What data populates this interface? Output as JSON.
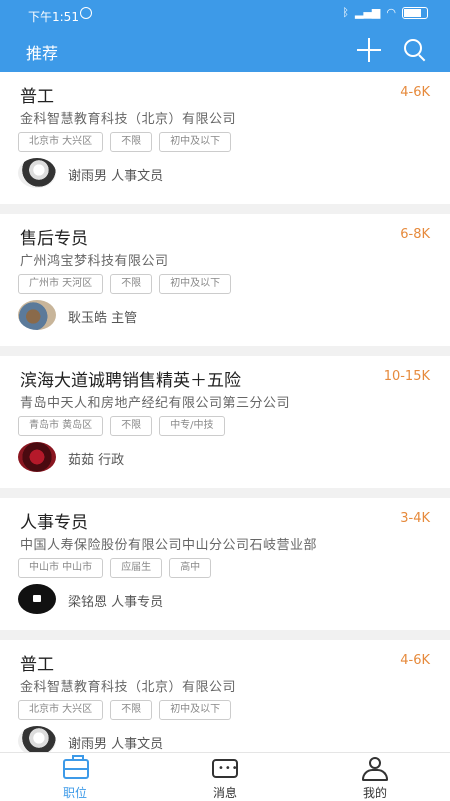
{
  "status": {
    "time": "下午1:51"
  },
  "appbar": {
    "title": "推荐"
  },
  "jobs": [
    {
      "title": "普工",
      "salary": "4-6K",
      "company": "金科智慧教育科技（北京）有限公司",
      "tags": [
        "北京市 大兴区",
        "不限",
        "初中及以下"
      ],
      "contact": "谢雨男 人事文员"
    },
    {
      "title": "售后专员",
      "salary": "6-8K",
      "company": "广州鸿宝梦科技有限公司",
      "tags": [
        "广州市 天河区",
        "不限",
        "初中及以下"
      ],
      "contact": "耿玉皓 主管"
    },
    {
      "title": "滨海大道诚聘销售精英＋五险",
      "salary": "10-15K",
      "company": "青岛中天人和房地产经纪有限公司第三分公司",
      "tags": [
        "青岛市 黄岛区",
        "不限",
        "中专/中技"
      ],
      "contact": "茹茹 行政"
    },
    {
      "title": "人事专员",
      "salary": "3-4K",
      "company": "中国人寿保险股份有限公司中山分公司石岐营业部",
      "tags": [
        "中山市 中山市",
        "应届生",
        "高中"
      ],
      "contact": "梁铭恩 人事专员"
    },
    {
      "title": "普工",
      "salary": "4-6K",
      "company": "金科智慧教育科技（北京）有限公司",
      "tags": [
        "北京市 大兴区",
        "不限",
        "初中及以下"
      ],
      "contact": "谢雨男 人事文员"
    }
  ],
  "tabbar": {
    "tabs": [
      {
        "label": "职位"
      },
      {
        "label": "消息"
      },
      {
        "label": "我的"
      }
    ]
  }
}
